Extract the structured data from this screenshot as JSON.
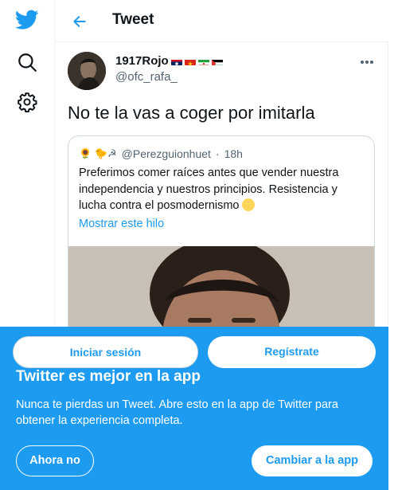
{
  "colors": {
    "accent": "#1d9bf0",
    "text": "#0f1419",
    "muted": "#536471",
    "border": "#cfd9de"
  },
  "rail": {
    "icons": [
      "twitter-bird-icon",
      "search-icon",
      "gear-icon"
    ]
  },
  "header": {
    "title": "Tweet",
    "back_icon": "arrow-left-icon"
  },
  "tweet": {
    "author_name": "1917Rojo",
    "author_flags": [
      "laos-flag",
      "vietnam-flag",
      "iran-flag",
      "palestine-flag"
    ],
    "author_handle": "@ofc_rafa_",
    "more_icon": "more-horizontal-icon",
    "text": "No te la vas a coger por imitarla"
  },
  "quote": {
    "emoji_prefix": "🌻 🐤☭",
    "handle": "@Perezguionhuet",
    "separator": "·",
    "time": "18h",
    "text": "Preferimos comer raíces antes que vender nuestra independencia y nuestros principios. Resistencia y lucha contra el posmodernismo",
    "show_thread": "Mostrar este hilo"
  },
  "auth": {
    "login": "Iniciar sesión",
    "signup": "Regístrate"
  },
  "app_banner": {
    "title": "Twitter es mejor en la app",
    "subtitle": "Nunca te pierdas un Tweet. Abre esto en la app de Twitter para obtener la experiencia completa.",
    "not_now": "Ahora no",
    "switch": "Cambiar a la app"
  }
}
